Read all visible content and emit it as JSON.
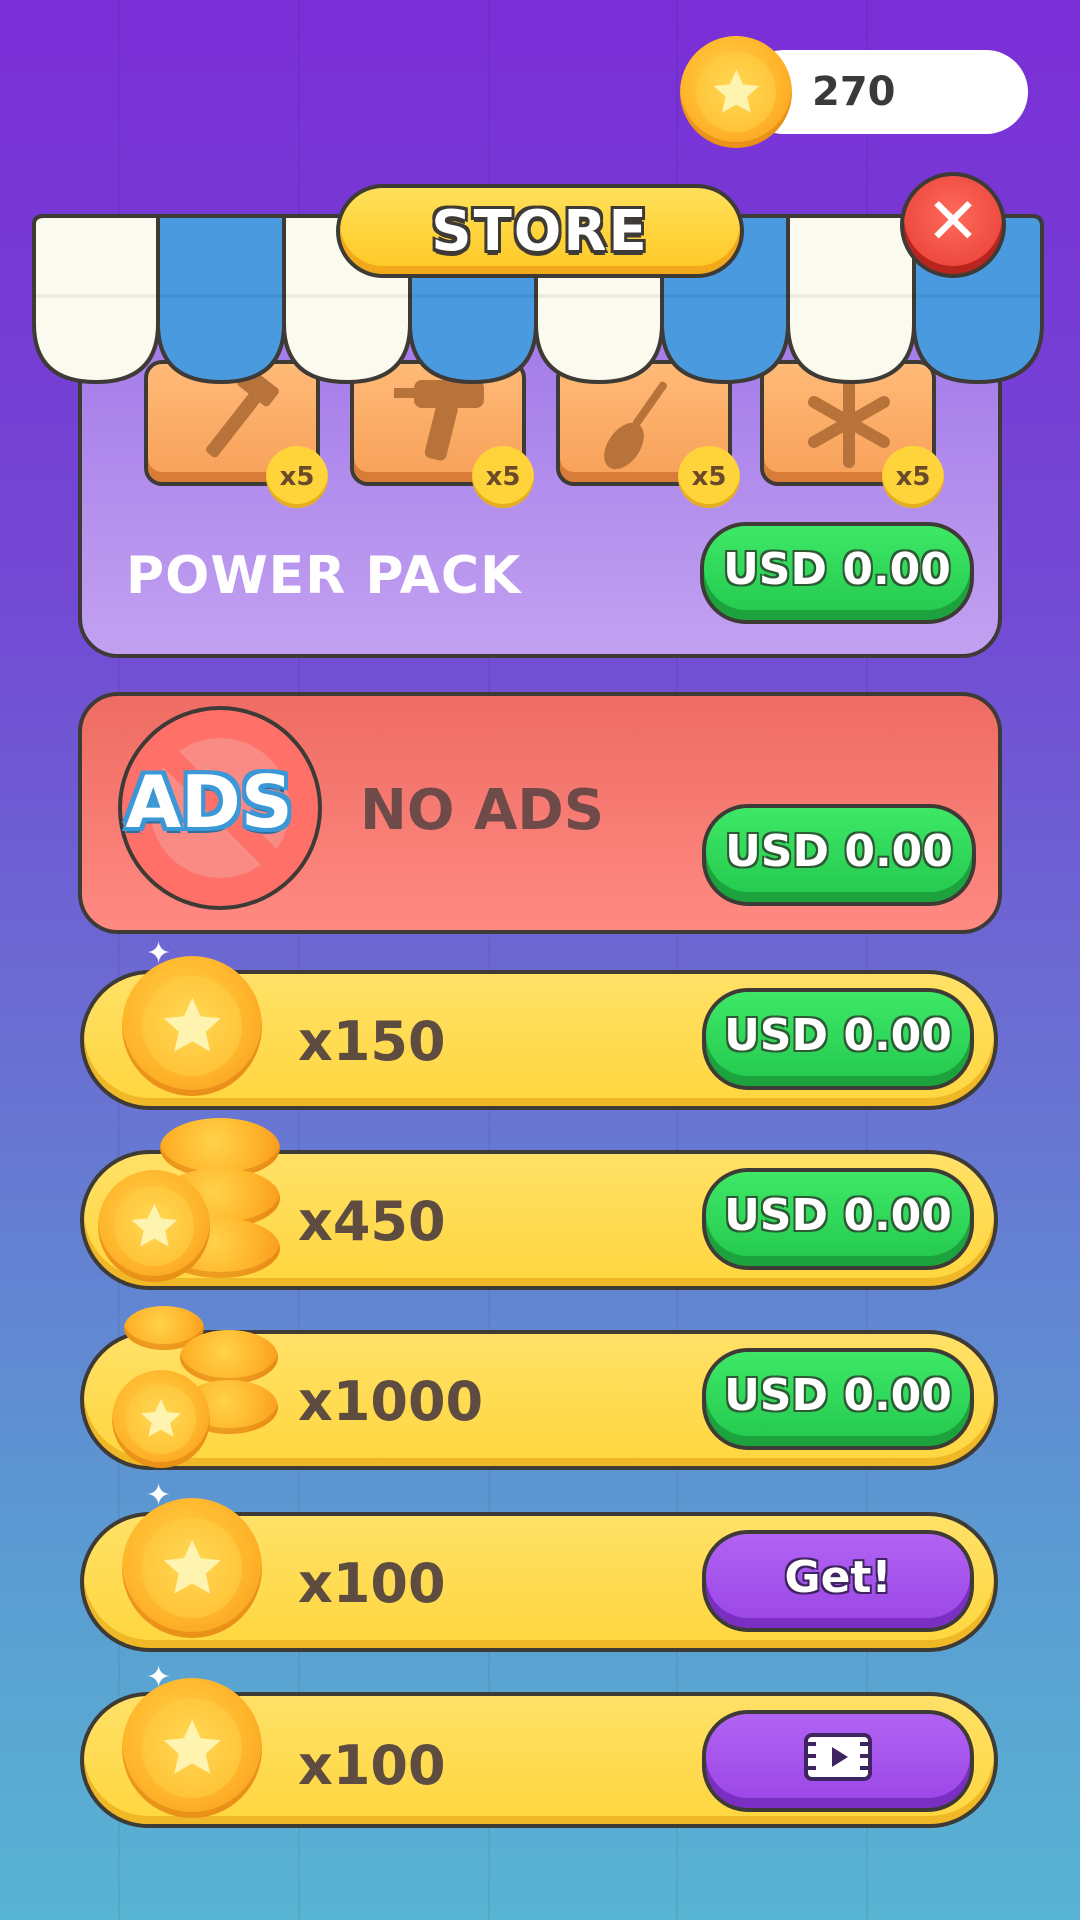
{
  "header": {
    "coin_balance": "270",
    "store_title": "STORE",
    "close_icon": "close-x"
  },
  "power_pack": {
    "label": "POWER PACK",
    "price": "USD 0.00",
    "items": [
      {
        "icon": "hammer-icon",
        "count": "x5"
      },
      {
        "icon": "drill-icon",
        "count": "x5"
      },
      {
        "icon": "screwdriver-icon",
        "count": "x5"
      },
      {
        "icon": "snowflake-icon",
        "count": "x5"
      }
    ]
  },
  "no_ads": {
    "icon_text": "ADS",
    "label": "NO ADS",
    "price": "USD 0.00"
  },
  "coin_offers": [
    {
      "amount": "x150",
      "button": "USD 0.00",
      "button_type": "price"
    },
    {
      "amount": "x450",
      "button": "USD 0.00",
      "button_type": "price"
    },
    {
      "amount": "x1000",
      "button": "USD 0.00",
      "button_type": "price"
    },
    {
      "amount": "x100",
      "button": "Get!",
      "button_type": "free"
    },
    {
      "amount": "x100",
      "button": "",
      "button_type": "video",
      "button_icon": "video-icon"
    }
  ],
  "colors": {
    "price_button": "#23c84d",
    "free_button": "#9b45e6",
    "row_fill": "#ffd63e",
    "pack_card": "#b18ced",
    "noads_card": "#f47a72"
  }
}
